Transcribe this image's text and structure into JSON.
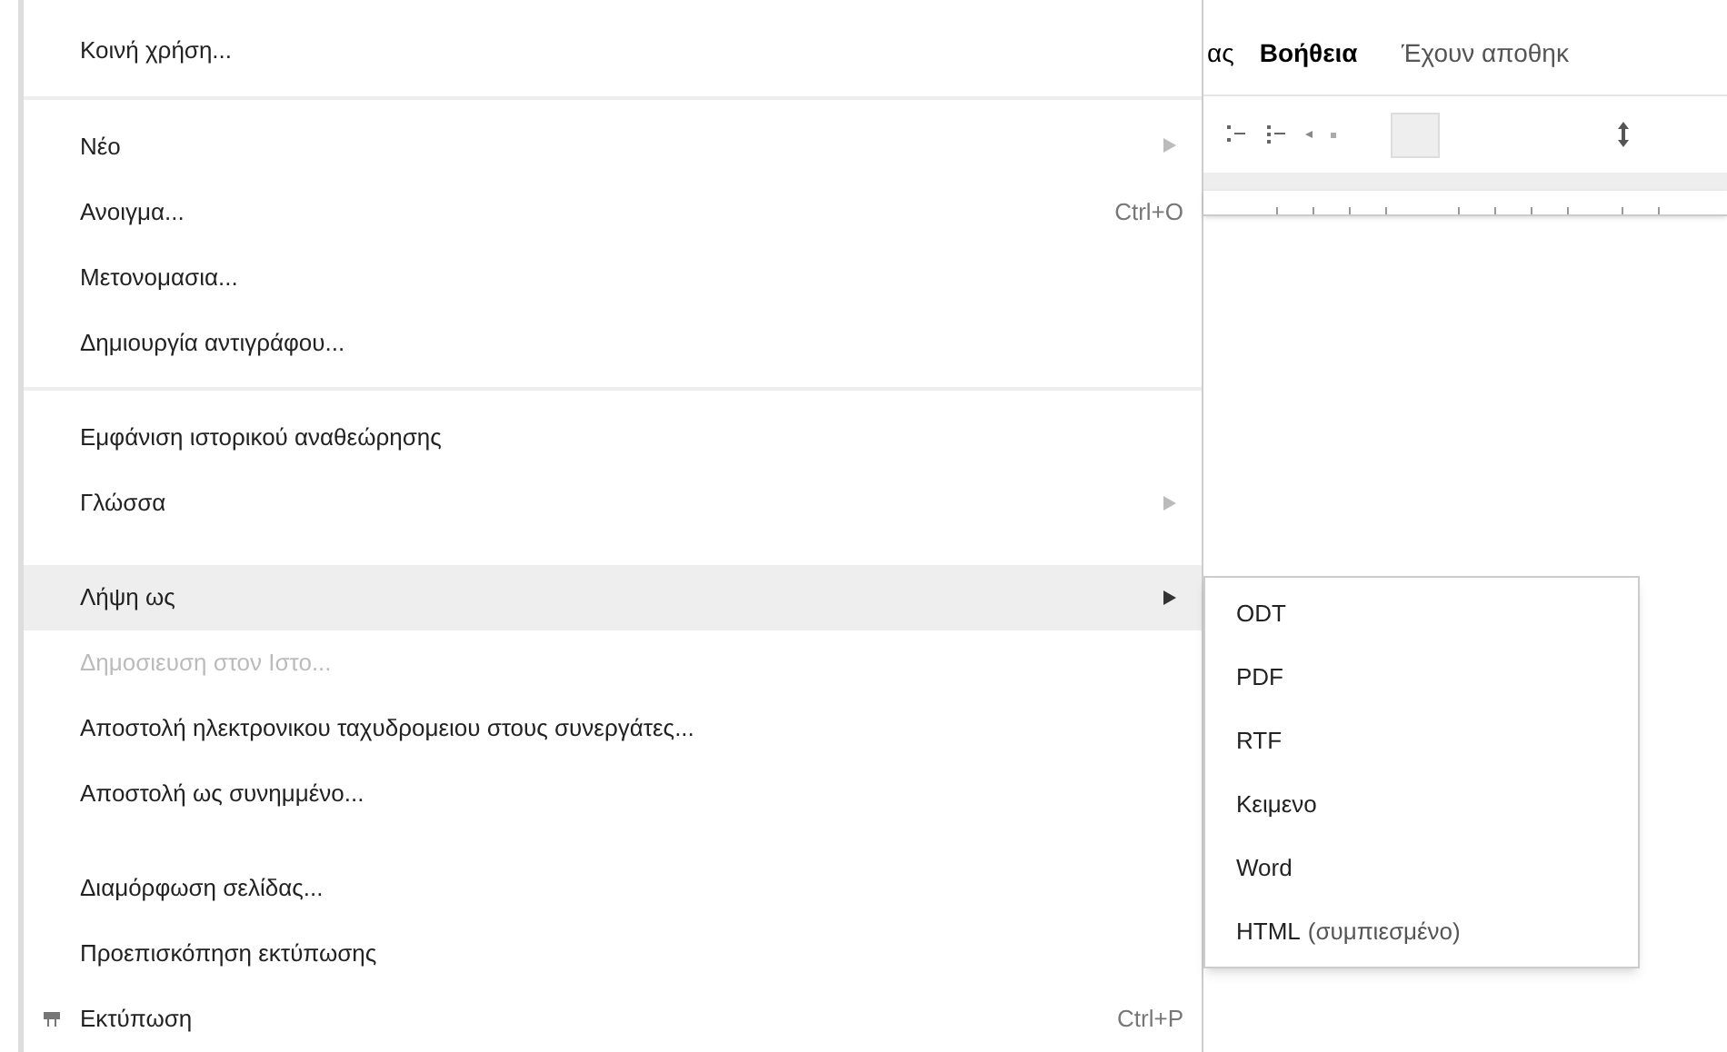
{
  "document_menubar": {
    "items": [
      {
        "label": "ας",
        "bold": false
      },
      {
        "label": "Βοήθεια",
        "bold": true
      }
    ],
    "save_status": "Έχουν αποθηκ"
  },
  "file_menu": [
    {
      "kind": "item",
      "label": "Κοινή χρήση...",
      "disabled": false,
      "selected": false
    },
    {
      "kind": "separator"
    },
    {
      "kind": "item",
      "label": "Νέο",
      "submenu": true,
      "disabled": false,
      "selected": false
    },
    {
      "kind": "item",
      "label": "Ανοιγμα...",
      "shortcut": "Ctrl+O",
      "disabled": false,
      "selected": false
    },
    {
      "kind": "item",
      "label": "Μετονομασια...",
      "disabled": false,
      "selected": false
    },
    {
      "kind": "item",
      "label": "Δημιουργία αντιγράφου...",
      "disabled": false,
      "selected": false
    },
    {
      "kind": "separator"
    },
    {
      "kind": "item",
      "label": "Εμφάνιση ιστορικού αναθεώρησης",
      "disabled": false,
      "selected": false
    },
    {
      "kind": "item",
      "label": "Γλώσσα",
      "submenu": true,
      "disabled": false,
      "selected": false
    },
    {
      "kind": "gap"
    },
    {
      "kind": "item",
      "label": "Λήψη ως",
      "submenu": true,
      "disabled": false,
      "selected": true
    },
    {
      "kind": "item",
      "label": "Δημοσιευση στον Ιστο...",
      "disabled": true,
      "selected": false
    },
    {
      "kind": "item",
      "label": "Αποστολή ηλεκτρονικου ταχυδρομειου στους συνεργάτες...",
      "disabled": false,
      "selected": false
    },
    {
      "kind": "item",
      "label": "Αποστολή ως συνημμένο...",
      "disabled": false,
      "selected": false
    },
    {
      "kind": "gap"
    },
    {
      "kind": "item",
      "label": "Διαμόρφωση σελίδας...",
      "disabled": false,
      "selected": false
    },
    {
      "kind": "item",
      "label": "Προεπισκόπηση εκτύπωσης",
      "disabled": false,
      "selected": false
    },
    {
      "kind": "print",
      "label": "Εκτύπωση",
      "shortcut": "Ctrl+P",
      "disabled": false,
      "selected": false
    }
  ],
  "download_submenu": [
    {
      "label": "ODT"
    },
    {
      "label": "PDF"
    },
    {
      "label": "RTF"
    },
    {
      "label": "Κειμενο"
    },
    {
      "label": "Word"
    },
    {
      "label": "HTML",
      "note": "(συμπιεσμένο)"
    }
  ]
}
